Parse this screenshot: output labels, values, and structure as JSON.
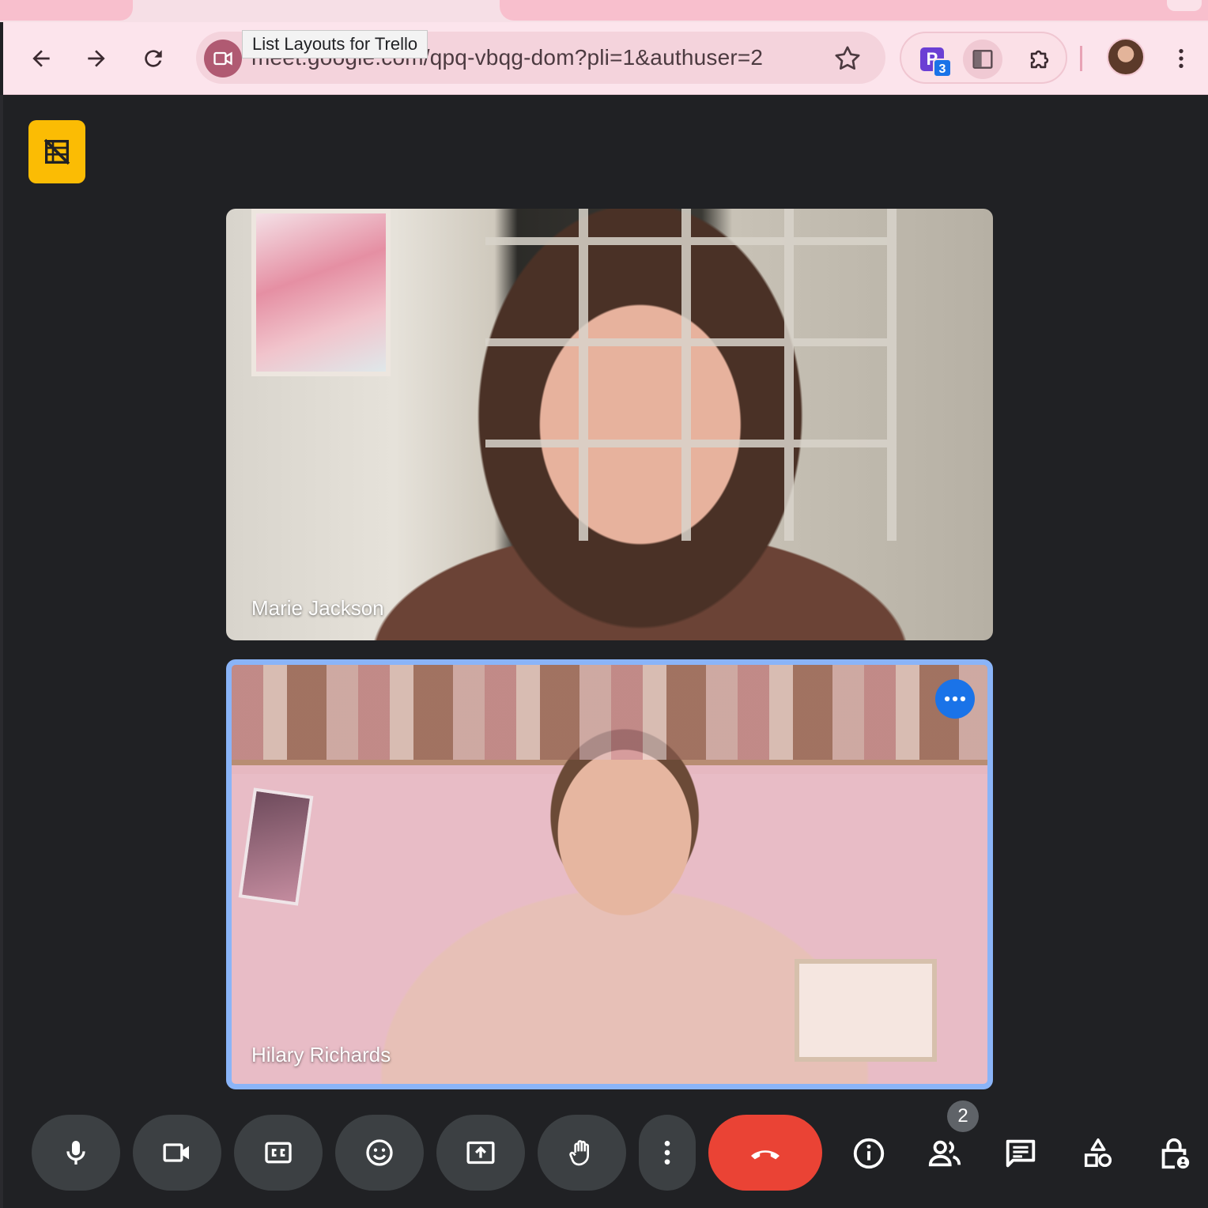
{
  "browser": {
    "url": "meet.google.com/qpq-vbqg-dom?pli=1&authuser=2",
    "tooltip": "List Layouts for Trello",
    "extension_badge": "3"
  },
  "participants": [
    {
      "name": "Marie Jackson"
    },
    {
      "name": "Hilary Richards"
    }
  ],
  "controls": {
    "people_count": "2"
  },
  "colors": {
    "end_call": "#ea4335",
    "active_speaker_border": "#8ab4f8",
    "notice_badge": "#fbbc04",
    "control_bg": "#3c4043",
    "chrome_toolbar": "#fce4ec"
  },
  "icons": [
    "back-icon",
    "forward-icon",
    "reload-icon",
    "video-camera-icon",
    "star-icon",
    "extension-p-icon",
    "side-panel-icon",
    "puzzle-icon",
    "profile-avatar",
    "menu-kebab-icon",
    "no-recording-icon",
    "more-options-icon",
    "mic-icon",
    "camera-icon",
    "captions-icon",
    "emoji-icon",
    "present-icon",
    "raise-hand-icon",
    "more-vert-icon",
    "end-call-icon",
    "info-icon",
    "people-icon",
    "chat-icon",
    "activities-icon",
    "host-controls-icon"
  ]
}
